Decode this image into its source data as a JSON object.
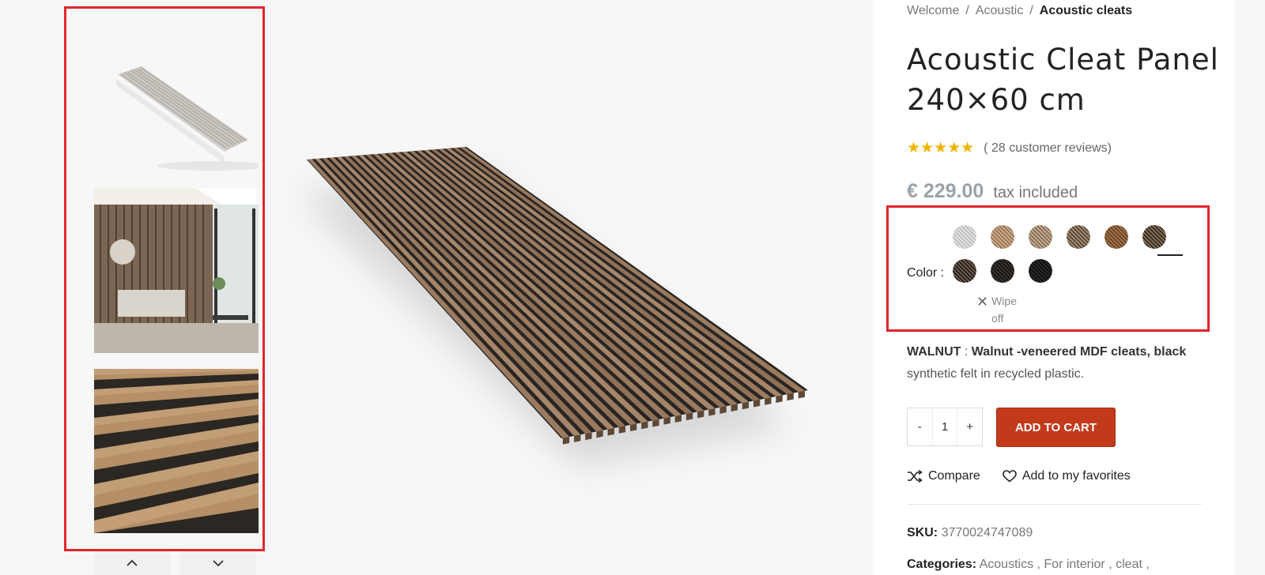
{
  "breadcrumb": {
    "items": [
      "Welcome",
      "Acoustic"
    ],
    "current": "Acoustic cleats",
    "separator": "/"
  },
  "product": {
    "title": "Acoustic Cleat Panel 240×60 cm",
    "rating_stars": "★★★★★",
    "reviews_open": "(",
    "reviews_count": "28",
    "reviews_label": "customer reviews)",
    "price": "€ 229.00",
    "tax_note": "tax included",
    "rating_value": 5
  },
  "color": {
    "label": "Color :",
    "swatches": [
      {
        "name": "white-oak",
        "fill": "#e4e4e4",
        "stroke": "#b9b9b9"
      },
      {
        "name": "light-oak",
        "fill": "#cfae8d",
        "stroke": "#8f6e50"
      },
      {
        "name": "natural-oak",
        "fill": "#c8ae93",
        "stroke": "#7d6752"
      },
      {
        "name": "smoked-oak",
        "fill": "#a88f74",
        "stroke": "#4d3f32"
      },
      {
        "name": "teak",
        "fill": "#a8774d",
        "stroke": "#5e3e22"
      },
      {
        "name": "walnut",
        "fill": "#8a7158",
        "stroke": "#2a231d"
      },
      {
        "name": "dark-walnut",
        "fill": "#6d5d4f",
        "stroke": "#1e1a17"
      },
      {
        "name": "black-oak",
        "fill": "#3a342f",
        "stroke": "#111"
      },
      {
        "name": "black",
        "fill": "#2b2b2b",
        "stroke": "#0c0c0c"
      }
    ],
    "selected": "walnut",
    "wipe_label": "Wipe off"
  },
  "description": {
    "name": "WALNUT",
    "sep": " : ",
    "bold": "Walnut -veneered MDF cleats, black",
    "rest": "synthetic felt in recycled plastic."
  },
  "cart": {
    "minus": "-",
    "quantity": "1",
    "plus": "+",
    "button": "ADD TO CART"
  },
  "actions": {
    "compare": "Compare",
    "favorites": "Add to my favorites"
  },
  "meta": {
    "sku_label": "SKU:",
    "sku_value": "3770024747089",
    "categories_label": "Categories:",
    "categories": [
      "Acoustics ,",
      "For interior ,",
      "cleat ,"
    ]
  },
  "colors": {
    "accent": "#c33a1b",
    "highlight": "#e0262b",
    "price": "#9aa3a8",
    "star": "#f0b400"
  }
}
